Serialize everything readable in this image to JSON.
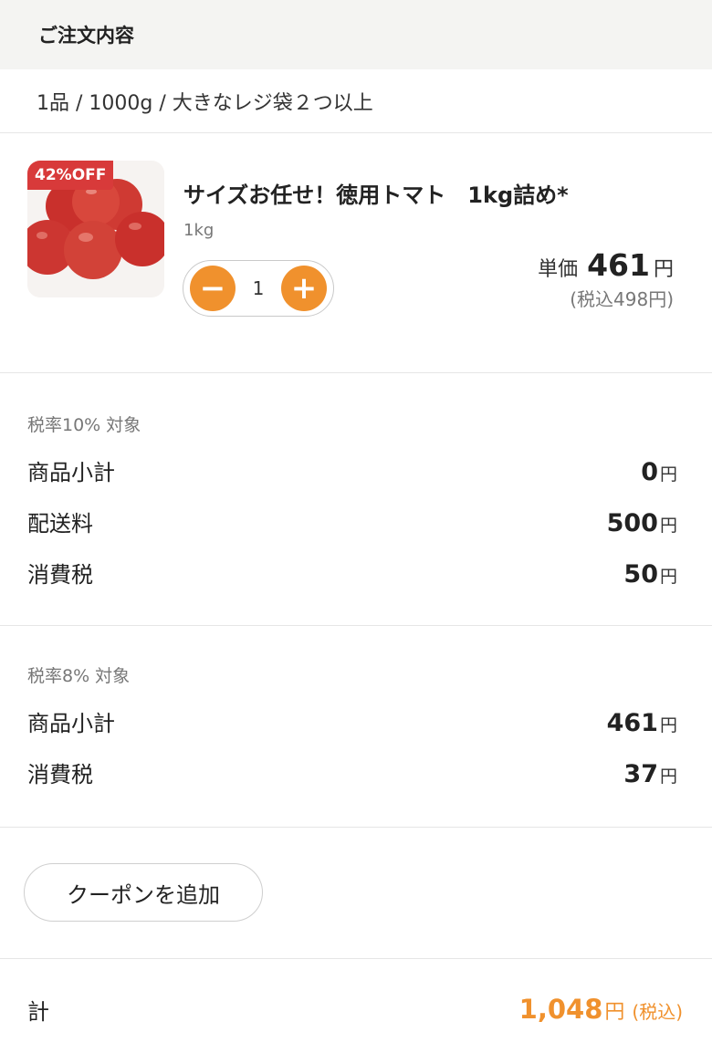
{
  "header": {
    "title": "ご注文内容"
  },
  "summary": {
    "text": "1品 / 1000g / 大きなレジ袋２つ以上"
  },
  "product": {
    "badge": "42%OFF",
    "name": "サイズお任せ！徳用トマト　1kg詰め*",
    "weight": "1kg",
    "quantity": "1",
    "minus_symbol": "−",
    "plus_symbol": "+",
    "unit_label": "単価",
    "unit_price": "461",
    "yen": "円",
    "tax_included": "(税込498円)"
  },
  "tax10": {
    "title": "税率10% 対象",
    "rows": [
      {
        "label": "商品小計",
        "value": "0",
        "unit": "円"
      },
      {
        "label": "配送料",
        "value": "500",
        "unit": "円"
      },
      {
        "label": "消費税",
        "value": "50",
        "unit": "円"
      }
    ]
  },
  "tax8": {
    "title": "税率8% 対象",
    "rows": [
      {
        "label": "商品小計",
        "value": "461",
        "unit": "円"
      },
      {
        "label": "消費税",
        "value": "37",
        "unit": "円"
      }
    ]
  },
  "coupon": {
    "label": "クーポンを追加"
  },
  "total": {
    "label": "計",
    "value": "1,048",
    "unit": "円",
    "tax_note": "(税込)"
  },
  "colors": {
    "accent": "#f0912d",
    "badge": "#d83a3a",
    "header_bg": "#f4f4f2"
  }
}
